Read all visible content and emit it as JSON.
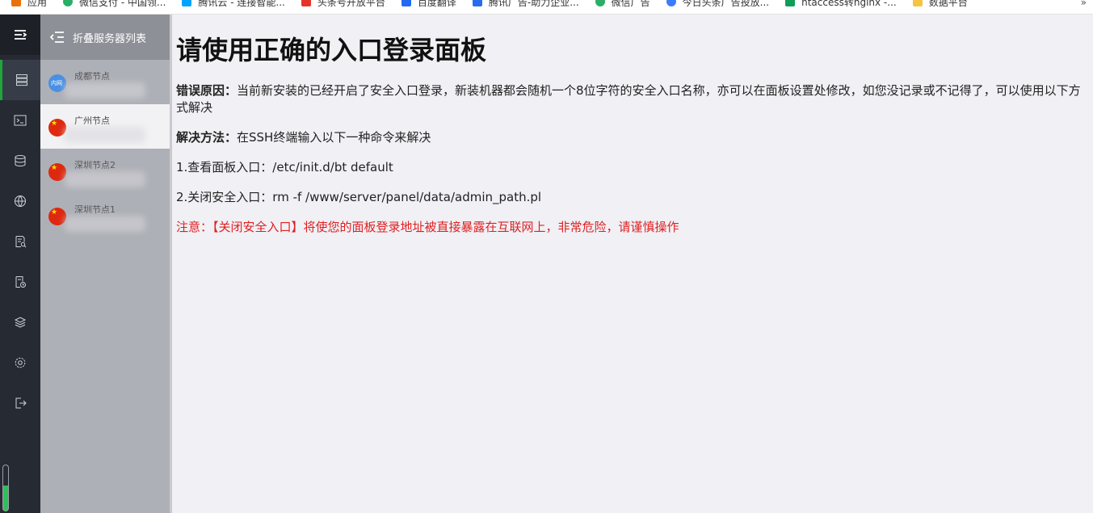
{
  "bookmarks": [
    {
      "label": "应用",
      "icon": "apps-icon",
      "color": "#e8710a"
    },
    {
      "label": "微信支付 - 中国领...",
      "icon": "wechat-icon",
      "color": "#2aae67"
    },
    {
      "label": "腾讯云 - 连接智能...",
      "icon": "tencent-cloud-icon",
      "color": "#00a4ff"
    },
    {
      "label": "头条号开放平台",
      "icon": "toutiao-icon",
      "color": "#e6332a"
    },
    {
      "label": "百度翻译",
      "icon": "baidu-translate-icon",
      "color": "#2468f2"
    },
    {
      "label": "腾讯广告-助力企业...",
      "icon": "tencent-ads-icon",
      "color": "#296bef"
    },
    {
      "label": "微信广告",
      "icon": "wechat-ads-icon",
      "color": "#2aae67"
    },
    {
      "label": "今日头条广告投放...",
      "icon": "ocean-engine-icon",
      "color": "#3b7cff"
    },
    {
      "label": "htaccess转nginx -...",
      "icon": "sheet-icon",
      "color": "#0f9d58"
    },
    {
      "label": "数据平台",
      "icon": "folder-icon",
      "color": "#f4c542"
    }
  ],
  "bookmarks_more": "»",
  "panel": {
    "collapse_label": "折叠服务器列表",
    "servers": [
      {
        "name": "成都节点",
        "flag": "lan",
        "active": false
      },
      {
        "name": "广州节点",
        "flag": "cn",
        "active": true
      },
      {
        "name": "深圳节点2",
        "flag": "cn",
        "active": false
      },
      {
        "name": "深圳节点1",
        "flag": "cn",
        "active": false
      }
    ]
  },
  "main": {
    "title": "请使用正确的入口登录面板",
    "reason_label": "错误原因：",
    "reason_text": "当前新安装的已经开启了安全入口登录，新装机器都会随机一个8位字符的安全入口名称，亦可以在面板设置处修改，如您没记录或不记得了，可以使用以下方式解决",
    "solution_label": "解决方法：",
    "solution_text": "在SSH终端输入以下一种命令来解决",
    "step1": "1.查看面板入口：/etc/init.d/bt default",
    "step2": "2.关闭安全入口：rm -f /www/server/panel/data/admin_path.pl",
    "warning": "注意：【关闭安全入口】将使您的面板登录地址被直接暴露在互联网上，非常危险，请谨慎操作"
  },
  "colors": {
    "rail_bg": "#262a33",
    "active_accent": "#20a53a",
    "warning": "#e02020"
  }
}
